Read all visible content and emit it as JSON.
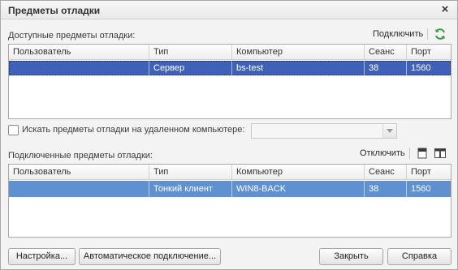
{
  "window": {
    "title": "Предметы отладки",
    "close_glyph": "×"
  },
  "available": {
    "label": "Доступные предметы отладки:",
    "connect_label": "Подключить",
    "refresh_icon": "refresh-icon",
    "columns": [
      "Пользователь",
      "Тип",
      "Компьютер",
      "Сеанс",
      "Порт"
    ],
    "rows": [
      {
        "user": "",
        "type": "Сервер",
        "computer": "bs-test",
        "session": "38",
        "port": "1560"
      }
    ]
  },
  "remote": {
    "label": "Искать предметы отладки на удаленном компьютере:",
    "checked": false,
    "computer_value": ""
  },
  "connected": {
    "label": "Подключенные предметы отладки:",
    "disconnect_label": "Отключить",
    "icons": [
      "document-icon",
      "split-view-icon"
    ],
    "columns": [
      "Пользователь",
      "Тип",
      "Компьютер",
      "Сеанс",
      "Порт"
    ],
    "rows": [
      {
        "user": "",
        "type": "Тонкий клиент",
        "computer": "WIN8-BACK",
        "session": "38",
        "port": "1560"
      }
    ]
  },
  "buttons": {
    "settings": "Настройка...",
    "auto_connect": "Автоматическое подключение...",
    "close": "Закрыть",
    "help": "Справка"
  },
  "colors": {
    "selection_active": "#3f62b8",
    "selection_inactive": "#5f90d0",
    "refresh_green": "#3c9a3c"
  }
}
